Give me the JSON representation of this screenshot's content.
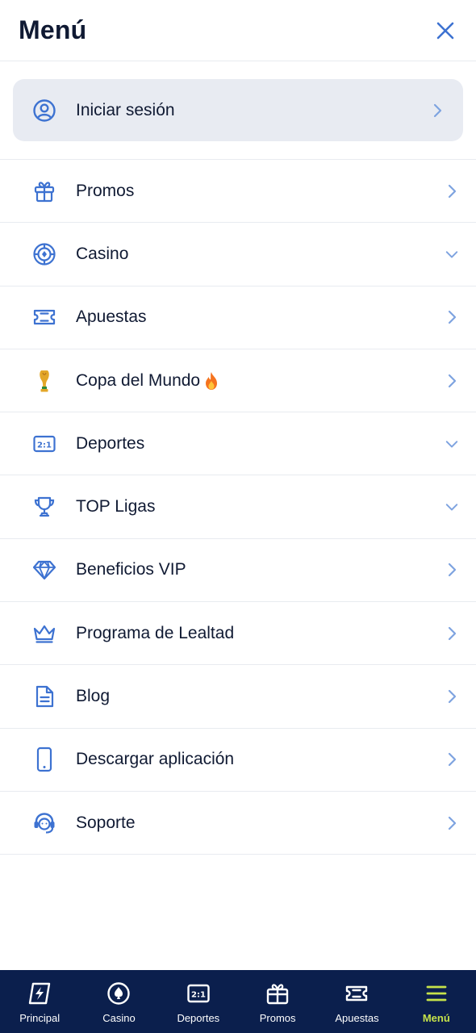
{
  "header": {
    "title": "Menú"
  },
  "login": {
    "label": "Iniciar sesión"
  },
  "menu": [
    {
      "label": "Promos",
      "icon": "gift-icon",
      "chevron": "right"
    },
    {
      "label": "Casino",
      "icon": "casino-chip-icon",
      "chevron": "down"
    },
    {
      "label": "Apuestas",
      "icon": "ticket-icon",
      "chevron": "right"
    },
    {
      "label": "Copa del Mundo",
      "icon": "world-cup-trophy-icon",
      "chevron": "right",
      "badge": "fire-icon"
    },
    {
      "label": "Deportes",
      "icon": "scoreboard-icon",
      "chevron": "down"
    },
    {
      "label": "TOP Ligas",
      "icon": "trophy-icon",
      "chevron": "down"
    },
    {
      "label": "Beneficios VIP",
      "icon": "diamond-icon",
      "chevron": "right"
    },
    {
      "label": "Programa de Lealtad",
      "icon": "crown-icon",
      "chevron": "right"
    },
    {
      "label": "Blog",
      "icon": "document-icon",
      "chevron": "right"
    },
    {
      "label": "Descargar aplicación",
      "icon": "phone-icon",
      "chevron": "right"
    },
    {
      "label": "Soporte",
      "icon": "headset-icon",
      "chevron": "right"
    }
  ],
  "bottom_nav": [
    {
      "label": "Principal",
      "icon": "lightning-icon",
      "active": false
    },
    {
      "label": "Casino",
      "icon": "casino-chip-icon",
      "active": false
    },
    {
      "label": "Deportes",
      "icon": "scoreboard-icon",
      "active": false
    },
    {
      "label": "Promos",
      "icon": "gift-icon",
      "active": false
    },
    {
      "label": "Apuestas",
      "icon": "ticket-icon",
      "active": false
    },
    {
      "label": "Menú",
      "icon": "hamburger-icon",
      "active": true
    }
  ],
  "colors": {
    "accent": "#3d72d1",
    "nav_bg": "#0b1f4d",
    "active_nav": "#c6e34a",
    "login_bg": "#e8ebf2"
  }
}
